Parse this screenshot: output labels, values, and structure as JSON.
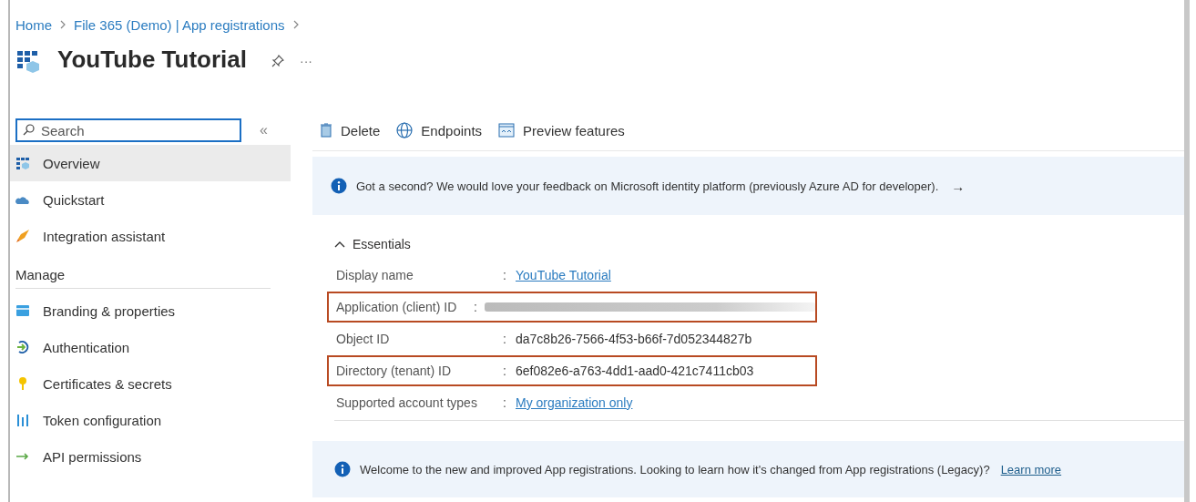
{
  "breadcrumb": [
    {
      "label": "Home"
    },
    {
      "label": "File 365 (Demo) | App registrations"
    }
  ],
  "title": "YouTube Tutorial",
  "more": "···",
  "search": {
    "placeholder": "Search"
  },
  "collapse": "«",
  "sidebar": {
    "items": [
      {
        "label": "Overview",
        "selected": true
      },
      {
        "label": "Quickstart",
        "selected": false
      },
      {
        "label": "Integration assistant",
        "selected": false
      }
    ],
    "section": "Manage",
    "manage_items": [
      {
        "label": "Branding & properties",
        "selected": false
      },
      {
        "label": "Authentication",
        "selected": false
      },
      {
        "label": "Certificates & secrets",
        "selected": false
      },
      {
        "label": "Token configuration",
        "selected": false
      },
      {
        "label": "API permissions",
        "selected": false
      }
    ]
  },
  "toolbar": [
    {
      "label": "Delete"
    },
    {
      "label": "Endpoints"
    },
    {
      "label": "Preview features"
    }
  ],
  "feedback_banner": {
    "text": "Got a second? We would love your feedback on Microsoft identity platform (previously Azure AD for developer).",
    "arrow": "→"
  },
  "essentials": {
    "title": "Essentials",
    "expanded": true,
    "properties": [
      {
        "label": "Display name",
        "separator": ":",
        "kind": "link",
        "value": "YouTube Tutorial",
        "highlighted": false
      },
      {
        "label": "Application (client) ID",
        "separator": ":",
        "kind": "redacted",
        "highlighted": true
      },
      {
        "label": "Object ID",
        "separator": ":",
        "kind": "text",
        "value": "da7c8b26-7566-4f53-b66f-7d052344827b",
        "highlighted": false
      },
      {
        "label": "Directory (tenant) ID",
        "separator": ":",
        "kind": "text",
        "value": "6ef082e6-a763-4dd1-aad0-421c7411cb03",
        "highlighted": true
      },
      {
        "label": "Supported account types",
        "separator": ":",
        "kind": "link",
        "value": "My organization only",
        "highlighted": false
      }
    ]
  },
  "info_banner": {
    "text": "Welcome to the new and improved App registrations. Looking to learn how it's changed from App registrations (Legacy)?",
    "link": "Learn more"
  }
}
